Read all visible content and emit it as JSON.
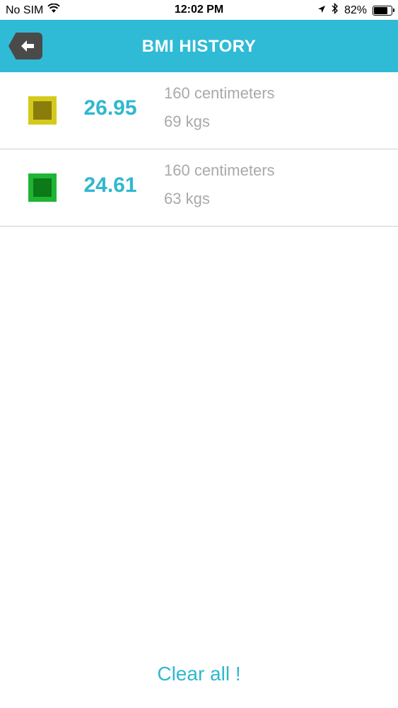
{
  "status_bar": {
    "carrier": "No SIM",
    "time": "12:02 PM",
    "battery_percent": "82%",
    "battery_level": 0.82
  },
  "header": {
    "title": "BMI HISTORY",
    "back_icon": "back-arrow-icon",
    "color": "#2fbbd6"
  },
  "history": [
    {
      "bmi": "26.95",
      "height": "160 centimeters",
      "weight": "69 kgs",
      "indicator_outer": "#d4ca1c",
      "indicator_inner": "#8a7d0b"
    },
    {
      "bmi": "24.61",
      "height": "160 centimeters",
      "weight": "63 kgs",
      "indicator_outer": "#1fb533",
      "indicator_inner": "#0b7a17"
    }
  ],
  "footer": {
    "clear_label": "Clear all !"
  }
}
